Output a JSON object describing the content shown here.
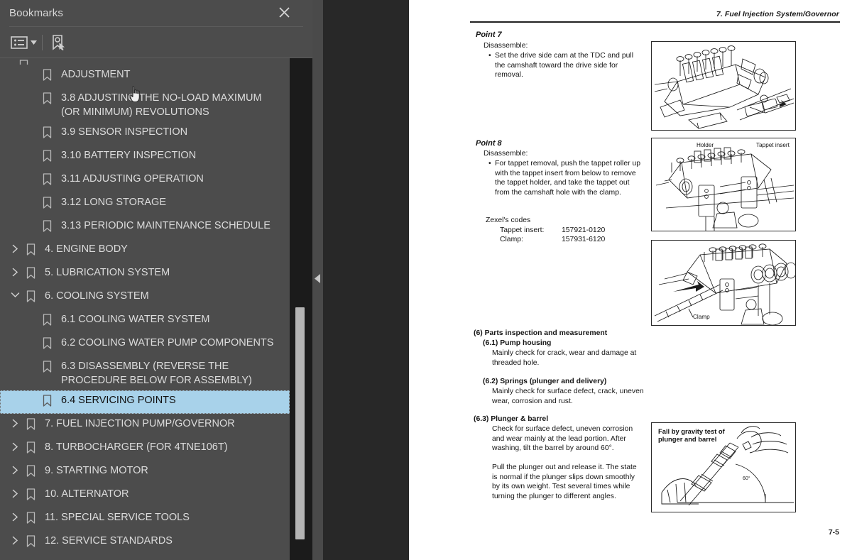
{
  "panel": {
    "title": "Bookmarks",
    "close_icon": "close-icon",
    "toolbar": {
      "list_options_icon": "list-options-icon",
      "caret_icon": "chevron-down-icon",
      "new_bookmark_icon": "new-bookmark-icon"
    }
  },
  "tree": {
    "items": [
      {
        "label": "ADJUSTMENT",
        "level": 1,
        "twisty": "",
        "selected": false,
        "clipped_above": true
      },
      {
        "label": "3.8 ADJUSTING THE NO-LOAD MAXIMUM (OR MINIMUM) REVOLUTIONS",
        "level": 1,
        "twisty": "",
        "selected": false
      },
      {
        "label": "3.9 SENSOR INSPECTION",
        "level": 1,
        "twisty": "",
        "selected": false
      },
      {
        "label": "3.10 BATTERY INSPECTION",
        "level": 1,
        "twisty": "",
        "selected": false
      },
      {
        "label": "3.11 ADJUSTING OPERATION",
        "level": 1,
        "twisty": "",
        "selected": false
      },
      {
        "label": "3.12 LONG STORAGE",
        "level": 1,
        "twisty": "",
        "selected": false
      },
      {
        "label": "3.13 PERIODIC MAINTENANCE SCHEDULE",
        "level": 1,
        "twisty": "",
        "selected": false
      },
      {
        "label": "4. ENGINE BODY",
        "level": 0,
        "twisty": "collapsed",
        "selected": false
      },
      {
        "label": "5. LUBRICATION SYSTEM",
        "level": 0,
        "twisty": "collapsed",
        "selected": false
      },
      {
        "label": "6. COOLING SYSTEM",
        "level": 0,
        "twisty": "expanded",
        "selected": false
      },
      {
        "label": "6.1 COOLING WATER SYSTEM",
        "level": 1,
        "twisty": "",
        "selected": false
      },
      {
        "label": "6.2 COOLING WATER PUMP COMPONENTS",
        "level": 1,
        "twisty": "",
        "selected": false
      },
      {
        "label": "6.3 DISASSEMBLY (REVERSE THE PROCEDURE BELOW FOR ASSEMBLY)",
        "level": 1,
        "twisty": "",
        "selected": false
      },
      {
        "label": "6.4 SERVICING POINTS",
        "level": 1,
        "twisty": "",
        "selected": true
      },
      {
        "label": "7. FUEL INJECTION PUMP/GOVERNOR",
        "level": 0,
        "twisty": "collapsed",
        "selected": false
      },
      {
        "label": "8. TURBOCHARGER (FOR 4TNE106T)",
        "level": 0,
        "twisty": "collapsed",
        "selected": false
      },
      {
        "label": "9. STARTING MOTOR",
        "level": 0,
        "twisty": "collapsed",
        "selected": false
      },
      {
        "label": "10. ALTERNATOR",
        "level": 0,
        "twisty": "collapsed",
        "selected": false
      },
      {
        "label": "11. SPECIAL SERVICE TOOLS",
        "level": 0,
        "twisty": "collapsed",
        "selected": false
      },
      {
        "label": "12. SERVICE STANDARDS",
        "level": 0,
        "twisty": "collapsed",
        "selected": false
      }
    ]
  },
  "collapse_handle": {
    "icon": "collapse-left-arrow-icon"
  },
  "document": {
    "running_head": "7.  Fuel Injection System/Governor",
    "page_number": "7-5",
    "point7": {
      "heading": "Point 7",
      "subheading": "Disassemble:",
      "bullet": "Set the drive side cam at the TDC and pull the camshaft toward the drive side for removal."
    },
    "point8": {
      "heading": "Point 8",
      "subheading": "Disassemble:",
      "bullet": "For tappet removal, push the tappet roller up with the tappet insert from below to remove the tappet holder, and take the tappet out from the camshaft hole with the clamp.",
      "codes_title": "Zexel's codes",
      "codes": [
        {
          "name": "Tappet insert:",
          "value": "157921-0120"
        },
        {
          "name": "Clamp:",
          "value": "157931-6120"
        }
      ]
    },
    "section6": {
      "heading": "(6) Parts inspection and measurement",
      "sub1": {
        "heading": "(6.1) Pump housing",
        "body": "Mainly check for crack, wear and damage at threaded hole."
      },
      "sub2": {
        "heading": "(6.2)   Springs (plunger and delivery)",
        "body": "Mainly check for surface defect, crack, uneven wear, corrosion and rust."
      },
      "sub3": {
        "heading": "(6.3) Plunger & barrel",
        "body1": "Check for surface defect, uneven corrosion and wear mainly at the lead portion. After washing, tilt the barrel by around 60°.",
        "body2": "Pull the plunger out and release it. The state is normal if the plunger slips down smoothly by its own weight. Test several times while turning the plunger to different angles."
      }
    },
    "figures": [
      {
        "name": "camshaft-removal-figure",
        "labels": []
      },
      {
        "name": "tappet-holder-figure",
        "labels": [
          "Holder",
          "Tappet insert"
        ]
      },
      {
        "name": "clamp-removal-figure",
        "labels": [
          "Clamp"
        ]
      },
      {
        "name": "gravity-test-figure",
        "labels": [
          "Fall by gravity test of plunger and barrel",
          "60°"
        ]
      }
    ]
  }
}
